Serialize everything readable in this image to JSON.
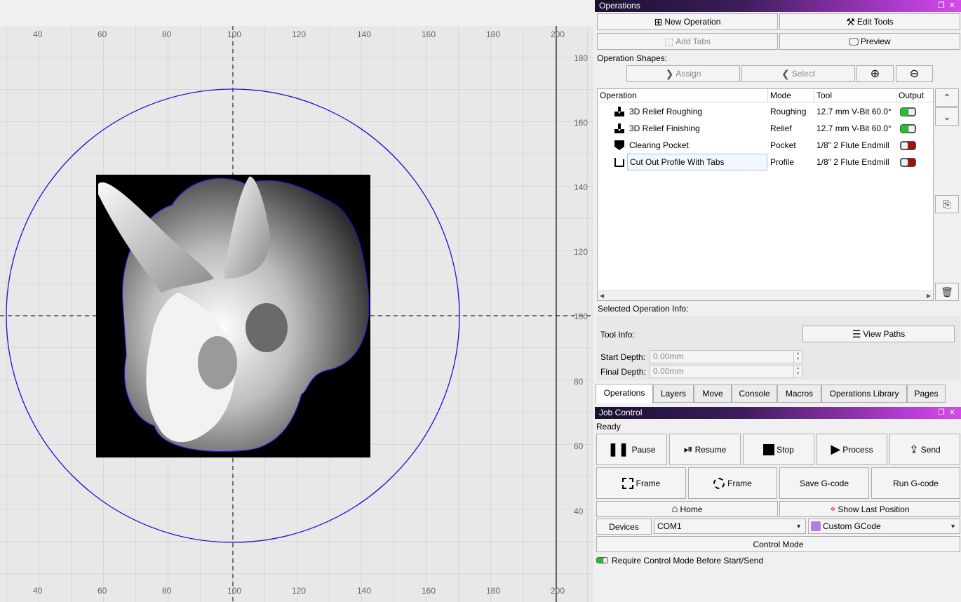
{
  "canvas": {
    "x_ticks": [
      "40",
      "60",
      "80",
      "100",
      "120",
      "140",
      "160",
      "180",
      "200"
    ],
    "y_ticks": [
      "180",
      "160",
      "140",
      "120",
      "100",
      "80",
      "60",
      "40"
    ]
  },
  "operations_panel": {
    "title": "Operations",
    "new_operation": "New Operation",
    "edit_tools": "Edit Tools",
    "add_tabs": "Add Tabs",
    "preview": "Preview",
    "operation_shapes_label": "Operation Shapes:",
    "assign": "Assign",
    "select": "Select",
    "table_headers": {
      "operation": "Operation",
      "mode": "Mode",
      "tool": "Tool",
      "output": "Output"
    },
    "rows": [
      {
        "name": "3D Relief Roughing",
        "mode": "Roughing",
        "tool": "12.7 mm V-Bit 60.0°",
        "output": "on",
        "icon": "relief-roughing-icon"
      },
      {
        "name": "3D Relief Finishing",
        "mode": "Relief",
        "tool": "12.7 mm V-Bit 60.0°",
        "output": "on",
        "icon": "relief-finishing-icon"
      },
      {
        "name": "Clearing Pocket",
        "mode": "Pocket",
        "tool": "1/8\" 2 Flute Endmill",
        "output": "off",
        "icon": "pocket-icon"
      },
      {
        "name": "Cut Out Profile With Tabs",
        "mode": "Profile",
        "tool": "1/8\" 2 Flute Endmill",
        "output": "off",
        "icon": "profile-icon"
      }
    ],
    "selected_info_label": "Selected Operation Info:",
    "tool_info_label": "Tool Info:",
    "view_paths": "View Paths",
    "start_depth_label": "Start Depth:",
    "start_depth_value": "0.00mm",
    "final_depth_label": "Final Depth:",
    "final_depth_value": "0.00mm"
  },
  "tabs": [
    "Operations",
    "Layers",
    "Move",
    "Console",
    "Macros",
    "Operations Library",
    "Pages"
  ],
  "job_control": {
    "title": "Job Control",
    "status": "Ready",
    "pause": "Pause",
    "resume": "Resume",
    "stop": "Stop",
    "process": "Process",
    "send": "Send",
    "frame_rect": "Frame",
    "frame_circle": "Frame",
    "save_gcode": "Save G-code",
    "run_gcode": "Run G-code",
    "home": "Home",
    "show_last_position": "Show Last Position",
    "devices": "Devices",
    "port": "COM1",
    "device_profile": "Custom GCode",
    "control_mode": "Control Mode",
    "require_control_mode": "Require Control Mode Before Start/Send"
  },
  "colors": {
    "circle": "#1515d6",
    "toggle_on": "#22c32a",
    "toggle_off": "#a01010"
  }
}
